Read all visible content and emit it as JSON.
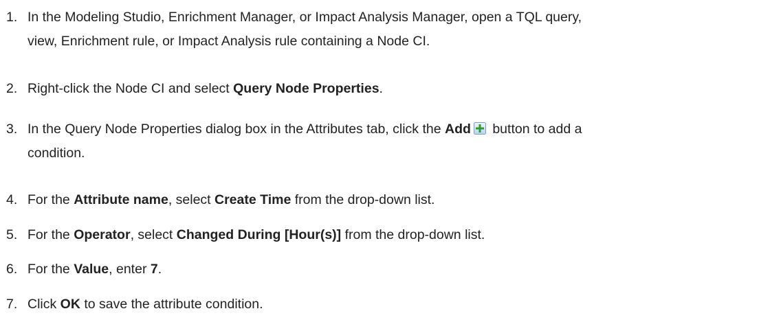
{
  "steps": [
    {
      "number": "1.",
      "line1": "In the Modeling Studio, Enrichment Manager, or Impact Analysis Manager, open a TQL query,",
      "line2": "view, Enrichment rule, or Impact Analysis rule containing a Node CI."
    },
    {
      "number": "2.",
      "pre": "Right-click the Node CI and select ",
      "bold": "Query Node Properties",
      "post": "."
    },
    {
      "number": "3.",
      "pre": "In the Query Node Properties dialog box in the Attributes tab, click the ",
      "bold": "Add",
      "icon": "add-plus-icon",
      "post": " button to add a",
      "line2": "condition."
    },
    {
      "number": "4.",
      "pre": "For the ",
      "bold1": "Attribute name",
      "mid": ", select ",
      "bold2": "Create Time",
      "post": " from the drop-down list."
    },
    {
      "number": "5.",
      "pre": "For the ",
      "bold1": "Operator",
      "mid": ", select ",
      "bold2": "Changed During [Hour(s)]",
      "post": " from the drop-down list."
    },
    {
      "number": "6.",
      "pre": "For the ",
      "bold1": "Value",
      "mid": ", enter ",
      "bold2": "7",
      "post": "."
    },
    {
      "number": "7.",
      "pre": "Click ",
      "bold": "OK",
      "post": " to save the attribute condition."
    }
  ]
}
